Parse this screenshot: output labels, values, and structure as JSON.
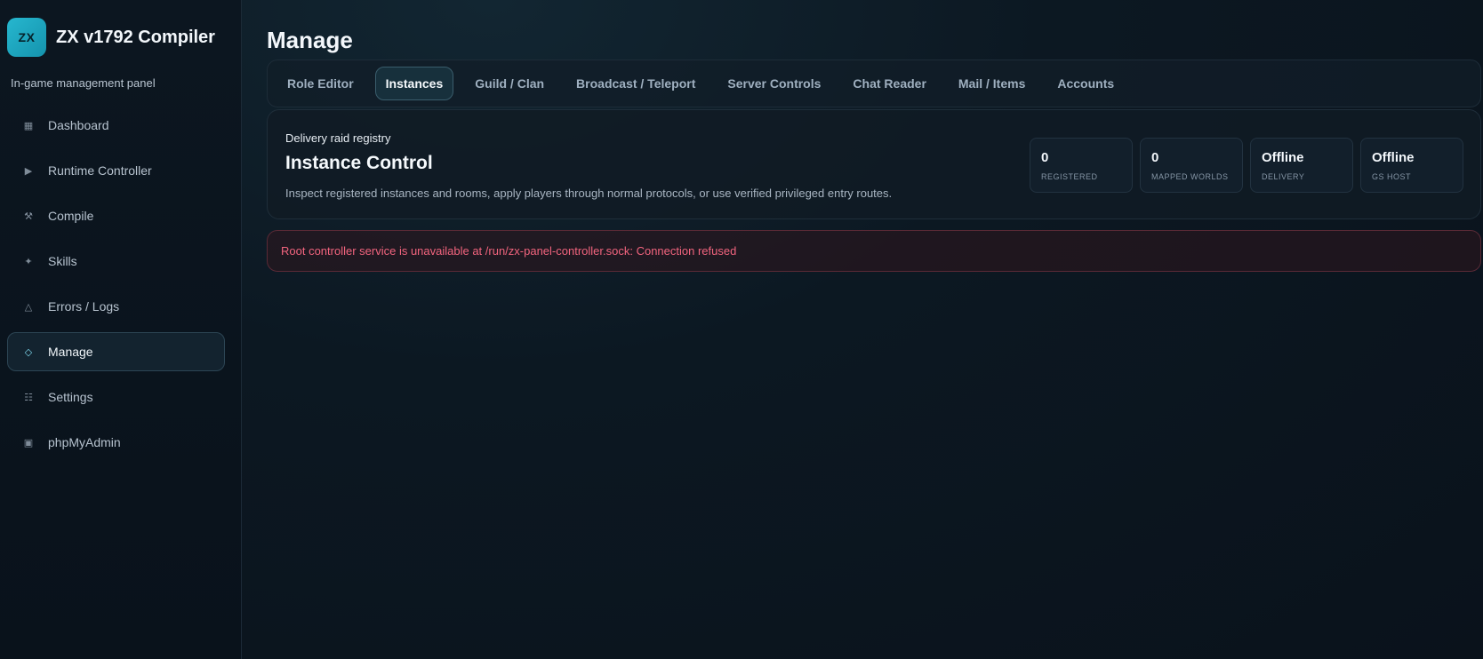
{
  "brand": {
    "logo_text": "ZX",
    "title": "ZX v1792 Compiler",
    "subtitle": "In-game management panel"
  },
  "sidebar": {
    "items": [
      {
        "label": "Dashboard",
        "icon": "grid-icon",
        "glyph": "▦",
        "active": false
      },
      {
        "label": "Runtime Controller",
        "icon": "play-icon",
        "glyph": "▶",
        "active": false
      },
      {
        "label": "Compile",
        "icon": "hammer-icon",
        "glyph": "⚒",
        "active": false
      },
      {
        "label": "Skills",
        "icon": "sparkle-icon",
        "glyph": "✦",
        "active": false
      },
      {
        "label": "Errors / Logs",
        "icon": "warning-icon",
        "glyph": "△",
        "active": false
      },
      {
        "label": "Manage",
        "icon": "diamond-icon",
        "glyph": "◇",
        "active": true
      },
      {
        "label": "Settings",
        "icon": "list-icon",
        "glyph": "☷",
        "active": false
      },
      {
        "label": "phpMyAdmin",
        "icon": "database-icon",
        "glyph": "▣",
        "active": false
      }
    ]
  },
  "main": {
    "title": "Manage",
    "tabs": [
      {
        "label": "Role Editor",
        "active": false
      },
      {
        "label": "Instances",
        "active": true
      },
      {
        "label": "Guild / Clan",
        "active": false
      },
      {
        "label": "Broadcast / Teleport",
        "active": false
      },
      {
        "label": "Server Controls",
        "active": false
      },
      {
        "label": "Chat Reader",
        "active": false
      },
      {
        "label": "Mail / Items",
        "active": false
      },
      {
        "label": "Accounts",
        "active": false
      }
    ],
    "card": {
      "kicker": "Delivery raid registry",
      "title": "Instance Control",
      "description": "Inspect registered instances and rooms, apply players through normal protocols, or use verified privileged entry routes.",
      "stats": [
        {
          "value": "0",
          "label": "REGISTERED"
        },
        {
          "value": "0",
          "label": "MAPPED WORLDS"
        },
        {
          "value": "Offline",
          "label": "DELIVERY"
        },
        {
          "value": "Offline",
          "label": "GS HOST"
        }
      ]
    },
    "alert": {
      "message": "Root controller service is unavailable at /run/zx-panel-controller.sock: Connection refused"
    }
  },
  "colors": {
    "accent": "#26b7cf",
    "error": "#f2647e",
    "background": "#0b131d"
  }
}
